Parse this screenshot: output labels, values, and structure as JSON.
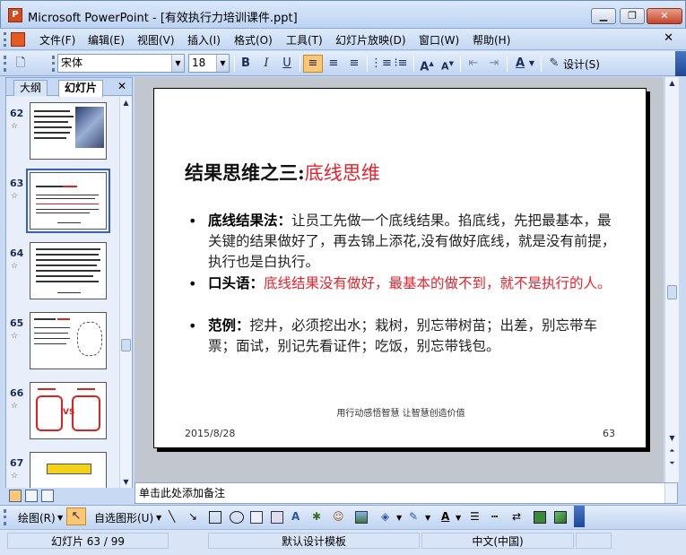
{
  "window": {
    "title": "Microsoft PowerPoint - [有效执行力培训课件.ppt]",
    "minimize": "▁",
    "restore": "❐",
    "close": "✕"
  },
  "menu": {
    "items": [
      "文件(F)",
      "编辑(E)",
      "视图(V)",
      "插入(I)",
      "格式(O)",
      "工具(T)",
      "幻灯片放映(D)",
      "窗口(W)",
      "帮助(H)"
    ],
    "close_doc": "✕"
  },
  "toolbar": {
    "font_name": "宋体",
    "font_size": "18",
    "bold": "B",
    "italic": "I",
    "underline": "U",
    "design_label": "设计(S)"
  },
  "left_panel": {
    "tabs": [
      "大纲",
      "幻灯片"
    ],
    "close": "✕",
    "slide_numbers": [
      "62",
      "63",
      "64",
      "65",
      "66",
      "67"
    ],
    "selected_slide": "63"
  },
  "slide": {
    "title_prefix": "结果思维之三:",
    "title_highlight": "底线思维",
    "bullets": [
      {
        "label": "底线结果法：",
        "text": "让员工先做一个底线结果。掐底线，先把最基本，最关键的结果做好了，再去锦上添花,没有做好底线，就是没有前提，执行也是白执行。",
        "red": false
      },
      {
        "label": "口头语：",
        "text": "底线结果没有做好，最基本的做不到，就不是执行的人。",
        "red": true
      },
      {
        "label": "范例：",
        "text": "挖井，必须挖出水；栽树，别忘带树苗；出差，别忘带车票；面试，别记先看证件；吃饭，别忘带钱包。",
        "red": false
      }
    ],
    "footer_center": "用行动感悟智慧 让智慧创造价值",
    "footer_date": "2015/8/28",
    "footer_number": "63"
  },
  "notes": {
    "placeholder": "单击此处添加备注"
  },
  "drawing_toolbar": {
    "draw_label": "绘图(R)",
    "autoshapes_label": "自选图形(U)"
  },
  "status": {
    "slide_info": "幻灯片 63 / 99",
    "template": "默认设计模板",
    "language": "中文(中国)"
  }
}
